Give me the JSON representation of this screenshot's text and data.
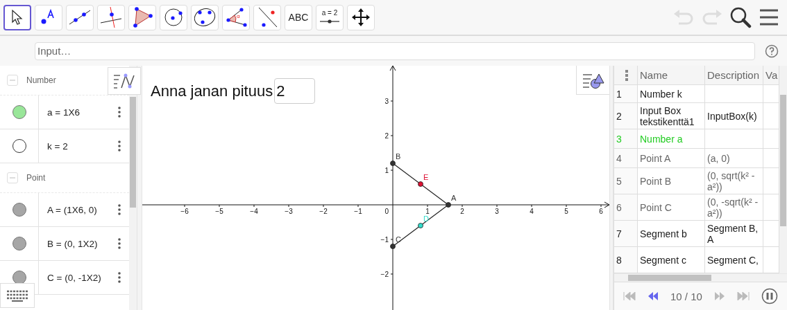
{
  "toolbar": {
    "tools": [
      {
        "kind": "move",
        "selected": true
      },
      {
        "kind": "point",
        "selected": false
      },
      {
        "kind": "line",
        "selected": false
      },
      {
        "kind": "perpendicular",
        "selected": false
      },
      {
        "kind": "polygon",
        "selected": false
      },
      {
        "kind": "circle",
        "selected": false
      },
      {
        "kind": "conic",
        "selected": false
      },
      {
        "kind": "angle",
        "label": "α",
        "selected": false
      },
      {
        "kind": "reflect",
        "selected": false
      },
      {
        "kind": "text",
        "label": "ABC",
        "selected": false
      },
      {
        "kind": "slider",
        "label": "a = 2",
        "selected": false
      },
      {
        "kind": "move-view",
        "selected": false
      }
    ]
  },
  "input_bar": {
    "placeholder": "Input…"
  },
  "algebra": {
    "groups": [
      {
        "title": "Number",
        "expanded": true,
        "items": [
          {
            "text": "a = 1X6",
            "shown": true,
            "color": "#99e699"
          },
          {
            "text": "k = 2",
            "shown": false
          }
        ]
      },
      {
        "title": "Point",
        "expanded": true,
        "items": [
          {
            "text": "A = (1X6, 0)",
            "shown": true,
            "color": "#a6a6a6"
          },
          {
            "text": "B = (0, 1X2)",
            "shown": true,
            "color": "#a6a6a6"
          },
          {
            "text": "C = (0, -1X2)",
            "shown": true,
            "color": "#a6a6a6"
          }
        ]
      }
    ]
  },
  "graphics": {
    "origin_label": "0",
    "input_box": {
      "label": "Anna janan pituus",
      "value": "2"
    },
    "chart_data": {
      "type": "scatter",
      "xlim": [
        -7.22,
        6.24
      ],
      "ylim": [
        -3.04,
        4.02
      ],
      "xticks": [
        {
          "value": -6,
          "label": "−6"
        },
        {
          "value": -5,
          "label": "−5"
        },
        {
          "value": -4,
          "label": "−4"
        },
        {
          "value": -3,
          "label": "−3"
        },
        {
          "value": -2,
          "label": "−2"
        },
        {
          "value": -1,
          "label": "−1"
        },
        {
          "value": 1,
          "label": "1"
        },
        {
          "value": 2,
          "label": "2"
        },
        {
          "value": 3,
          "label": "3"
        },
        {
          "value": 4,
          "label": "4"
        },
        {
          "value": 5,
          "label": "5"
        },
        {
          "value": 6,
          "label": "6"
        }
      ],
      "yticks": [
        {
          "value": -2,
          "label": "−2"
        },
        {
          "value": -1,
          "label": "−1"
        },
        {
          "value": 1,
          "label": "1"
        },
        {
          "value": 2,
          "label": "2"
        },
        {
          "value": 3,
          "label": "3"
        }
      ],
      "series": [
        {
          "name": "A",
          "color": "#333333",
          "x": [
            1.6
          ],
          "values": [
            0
          ]
        },
        {
          "name": "B",
          "color": "#333333",
          "x": [
            0
          ],
          "values": [
            1.2
          ]
        },
        {
          "name": "C",
          "color": "#333333",
          "x": [
            0
          ],
          "values": [
            -1.2
          ]
        },
        {
          "name": "E",
          "color": "#dd1133",
          "x": [
            0.8
          ],
          "values": [
            0.6
          ]
        },
        {
          "name": "D",
          "color": "#33ddcc",
          "x": [
            0.8
          ],
          "values": [
            -0.6
          ]
        }
      ]
    }
  },
  "spreadsheet": {
    "columns": [
      "Name",
      "Description",
      "Va"
    ],
    "rows": [
      {
        "index": "1",
        "name": "Number k",
        "color": "#1a1a1a"
      },
      {
        "index": "2",
        "name": "Input Box tekstikenttä1",
        "description": "InputBox(k)",
        "color": "#1a1a1a"
      },
      {
        "index": "3",
        "name": "Number a",
        "color": "#22cc22"
      },
      {
        "index": "4",
        "name": "Point A",
        "description": "(a, 0)",
        "color": "#666666"
      },
      {
        "index": "5",
        "name": "Point B",
        "description": "(0, sqrt(k² - a²))",
        "color": "#666666"
      },
      {
        "index": "6",
        "name": "Point C",
        "description": "(0, -sqrt(k² - a²))",
        "color": "#666666"
      },
      {
        "index": "7",
        "name": "Segment b",
        "description": "Segment B, A",
        "color": "#1a1a1a"
      },
      {
        "index": "8",
        "name": "Segment c",
        "description": "Segment C,",
        "color": "#1a1a1a"
      }
    ],
    "playback": {
      "counter": "10 / 10",
      "playing": true
    }
  }
}
